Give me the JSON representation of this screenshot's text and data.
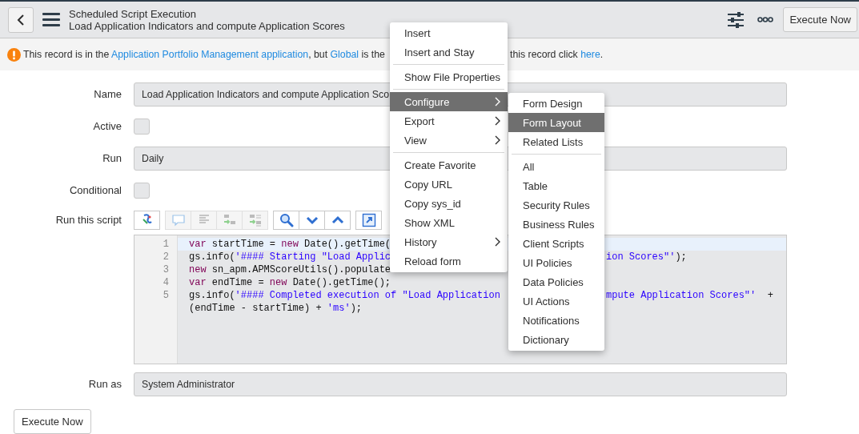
{
  "header": {
    "title": "Scheduled Script Execution",
    "subtitle": "Load Application Indicators and compute Application Scores",
    "action": "Execute Now"
  },
  "banner": {
    "parts": [
      [
        {
          "kind": "text",
          "text": "This record is in the "
        },
        {
          "kind": "link",
          "text": "Application Portfolio Management application"
        },
        {
          "kind": "text",
          "text": ", but "
        },
        {
          "kind": "link",
          "text": "Global"
        },
        {
          "kind": "text",
          "text": " is the"
        }
      ],
      [
        {
          "kind": "text",
          "text": "this record click "
        },
        {
          "kind": "link",
          "text": "here"
        },
        {
          "kind": "text",
          "text": "."
        }
      ]
    ]
  },
  "form": {
    "fields": [
      {
        "kind": "text",
        "label": "Name",
        "value": "Load Application Indicators and compute Application Sco"
      },
      {
        "kind": "checkbox",
        "label": "Active",
        "checked": false
      },
      {
        "kind": "text",
        "label": "Run",
        "value": "Daily"
      },
      {
        "kind": "checkbox",
        "label": "Conditional",
        "checked": false
      },
      {
        "kind": "script",
        "label": "Run this script",
        "toolbar": [
          [
            {
              "kind": "format",
              "disabled": false
            }
          ],
          [
            {
              "kind": "comment",
              "disabled": true
            },
            {
              "kind": "indent",
              "disabled": true
            },
            {
              "kind": "replace",
              "disabled": true
            },
            {
              "kind": "replace-all",
              "disabled": true
            }
          ],
          [
            {
              "kind": "search",
              "disabled": false
            },
            {
              "kind": "next",
              "disabled": false
            },
            {
              "kind": "previous",
              "disabled": false
            }
          ],
          [
            {
              "kind": "fullscreen",
              "disabled": false
            }
          ]
        ],
        "lines": [
          {
            "number": "1",
            "active": true,
            "left": [
              {
                "kind": "keyword",
                "text": "var"
              },
              {
                "kind": "plain",
                "text": " startTime = "
              },
              {
                "kind": "keyword",
                "text": "new"
              },
              {
                "kind": "plain",
                "text": " Date().getTime("
              }
            ]
          },
          {
            "number": "2",
            "active": false,
            "left": [
              {
                "kind": "plain",
                "text": "gs.info("
              },
              {
                "kind": "string",
                "text": "'#### Starting \"Load Applic"
              }
            ],
            "right": [
              {
                "kind": "string",
                "text": "ion Scores\"'"
              },
              {
                "kind": "plain",
                "text": ");"
              }
            ]
          },
          {
            "number": "3",
            "active": false,
            "left": [
              {
                "kind": "keyword",
                "text": "new"
              },
              {
                "kind": "plain",
                "text": " sn_apm.APMScoreUtils().populate"
              }
            ]
          },
          {
            "number": "4",
            "active": false,
            "left": [
              {
                "kind": "keyword",
                "text": "var"
              },
              {
                "kind": "plain",
                "text": " endTime = "
              },
              {
                "kind": "keyword",
                "text": "new"
              },
              {
                "kind": "plain",
                "text": " Date().getTime();"
              }
            ]
          },
          {
            "number": "5",
            "active": false,
            "left": [
              {
                "kind": "plain",
                "text": "gs.info("
              },
              {
                "kind": "string",
                "text": "'#### Completed execution of \"Load Application"
              }
            ],
            "right": [
              {
                "kind": "string",
                "text": "mpute Application Scores\"'"
              },
              {
                "kind": "plain",
                "text": "  +"
              }
            ]
          },
          {
            "active": false,
            "left": [
              {
                "kind": "plain",
                "text": "(endTime - startTime) + "
              },
              {
                "kind": "string",
                "text": "'ms'"
              },
              {
                "kind": "plain",
                "text": ");"
              }
            ]
          }
        ]
      },
      {
        "kind": "text",
        "label": "Run as",
        "value": "System Administrator"
      }
    ],
    "button": "Execute Now"
  },
  "context_menu": {
    "items": [
      {
        "kind": "item",
        "label": "Insert",
        "selected": false,
        "submenu": false
      },
      {
        "kind": "item",
        "label": "Insert and Stay",
        "selected": false,
        "submenu": false
      },
      {
        "kind": "divider"
      },
      {
        "kind": "item",
        "label": "Show File Properties",
        "selected": false,
        "submenu": false
      },
      {
        "kind": "divider"
      },
      {
        "kind": "item",
        "label": "Configure",
        "selected": true,
        "submenu": true
      },
      {
        "kind": "item",
        "label": "Export",
        "selected": false,
        "submenu": true
      },
      {
        "kind": "item",
        "label": "View",
        "selected": false,
        "submenu": true
      },
      {
        "kind": "divider"
      },
      {
        "kind": "item",
        "label": "Create Favorite",
        "selected": false,
        "submenu": false
      },
      {
        "kind": "item",
        "label": "Copy URL",
        "selected": false,
        "submenu": false
      },
      {
        "kind": "item",
        "label": "Copy sys_id",
        "selected": false,
        "submenu": false
      },
      {
        "kind": "item",
        "label": "Show XML",
        "selected": false,
        "submenu": false
      },
      {
        "kind": "item",
        "label": "History",
        "selected": false,
        "submenu": true
      },
      {
        "kind": "item",
        "label": "Reload form",
        "selected": false,
        "submenu": false
      }
    ]
  },
  "submenu": {
    "items": [
      {
        "kind": "item",
        "label": "Form Design",
        "selected": false,
        "submenu": false
      },
      {
        "kind": "item",
        "label": "Form Layout",
        "selected": true,
        "submenu": false
      },
      {
        "kind": "item",
        "label": "Related Lists",
        "selected": false,
        "submenu": false
      },
      {
        "kind": "divider"
      },
      {
        "kind": "item",
        "label": "All",
        "selected": false,
        "submenu": false
      },
      {
        "kind": "item",
        "label": "Table",
        "selected": false,
        "submenu": false
      },
      {
        "kind": "item",
        "label": "Security Rules",
        "selected": false,
        "submenu": false
      },
      {
        "kind": "item",
        "label": "Business Rules",
        "selected": false,
        "submenu": false
      },
      {
        "kind": "item",
        "label": "Client Scripts",
        "selected": false,
        "submenu": false
      },
      {
        "kind": "item",
        "label": "UI Policies",
        "selected": false,
        "submenu": false
      },
      {
        "kind": "item",
        "label": "Data Policies",
        "selected": false,
        "submenu": false
      },
      {
        "kind": "item",
        "label": "UI Actions",
        "selected": false,
        "submenu": false
      },
      {
        "kind": "item",
        "label": "Notifications",
        "selected": false,
        "submenu": false
      },
      {
        "kind": "item",
        "label": "Dictionary",
        "selected": false,
        "submenu": false
      }
    ]
  }
}
